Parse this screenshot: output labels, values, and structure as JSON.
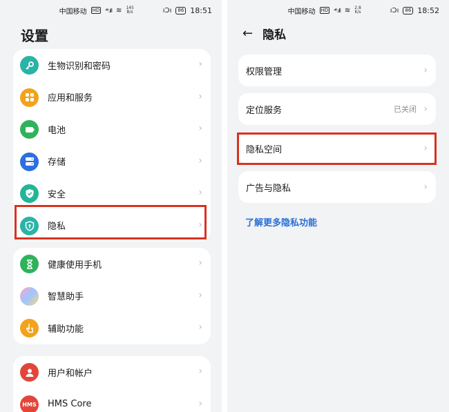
{
  "left": {
    "status": {
      "carrier": "中国移动",
      "net_speed": "145\nB/s",
      "signal": "⁴⁶.ıll",
      "wifi": "≋",
      "vibrate": "ıƆı",
      "battery": "86",
      "time": "18:51"
    },
    "title": "设置",
    "groups": [
      [
        {
          "label": "生物识别和密码",
          "icon": "key-icon",
          "color": "#2bb3a8"
        },
        {
          "label": "应用和服务",
          "icon": "apps-grid-icon",
          "color": "#f2a31b"
        },
        {
          "label": "电池",
          "icon": "battery-icon",
          "color": "#2fb35a"
        },
        {
          "label": "存储",
          "icon": "storage-icon",
          "color": "#2b6fe0"
        },
        {
          "label": "安全",
          "icon": "shield-check-icon",
          "color": "#22b59a"
        },
        {
          "label": "隐私",
          "icon": "privacy-shield-icon",
          "color": "#2bb3a8"
        }
      ],
      [
        {
          "label": "健康使用手机",
          "icon": "hourglass-icon",
          "color": "#2fb35a"
        },
        {
          "label": "智慧助手",
          "icon": "assistant-icon",
          "color": "#b98ee8"
        },
        {
          "label": "辅助功能",
          "icon": "hand-icon",
          "color": "#f2a31b"
        }
      ],
      [
        {
          "label": "用户和帐户",
          "icon": "user-icon",
          "color": "#e2463a"
        },
        {
          "label": "HMS Core",
          "icon": "hms-icon",
          "color": "#e2463a",
          "text": "HMS"
        }
      ]
    ]
  },
  "right": {
    "status": {
      "carrier": "中国移动",
      "net_speed": "2.8\nK/s",
      "signal": "⁴⁶.ıll",
      "wifi": "≋",
      "vibrate": "ıƆı",
      "battery": "86",
      "time": "18:52"
    },
    "back_arrow": "←",
    "title": "隐私",
    "items": [
      {
        "label": "权限管理",
        "value": ""
      },
      {
        "label": "定位服务",
        "value": "已关闭"
      },
      {
        "label": "隐私空间",
        "value": ""
      },
      {
        "label": "广告与隐私",
        "value": ""
      }
    ],
    "link": "了解更多隐私功能"
  },
  "chevron": "›",
  "colors": {
    "highlight": "#d8321f",
    "link": "#2a6fd6",
    "background": "#f1f3f5"
  }
}
